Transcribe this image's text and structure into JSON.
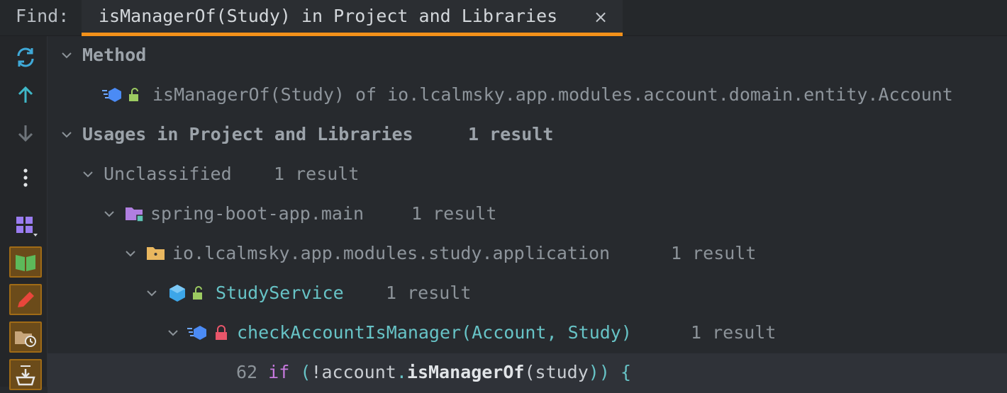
{
  "find": {
    "label": "Find:",
    "tab_title": "isManagerOf(Study) in Project and Libraries",
    "close_glyph": "×"
  },
  "sidebar": {
    "icons": [
      "refresh-icon",
      "arrow-up-icon",
      "arrow-down-icon",
      "more-vertical-icon",
      "layout-grid-icon",
      "book-icon",
      "pencil-icon",
      "folder-history-icon",
      "import-icon"
    ]
  },
  "tree": {
    "method_header": "Method",
    "method_item": "isManagerOf(Study) of io.lcalmsky.app.modules.account.domain.entity.Account",
    "usages_header": "Usages in Project and Libraries",
    "usages_count": "1 result",
    "unclassified": "Unclassified",
    "unclassified_count": "1 result",
    "module": "spring-boot-app.main",
    "module_count": "1 result",
    "package": "io.lcalmsky.app.modules.study.application",
    "package_count": "1 result",
    "class": "StudyService",
    "class_count": "1 result",
    "method": "checkAccountIsManager(Account, Study)",
    "method_count": "1 result",
    "code_line": {
      "line_number": "62",
      "keyword": "if",
      "open": "(",
      "bang_account": "!account",
      "dot": ".",
      "method": "isManagerOf",
      "args_open": "(",
      "arg": "study",
      "close": "))",
      "brace": "{"
    }
  },
  "colors": {
    "accent": "#F3911A",
    "teal": "#67C3C6",
    "keyword": "#C679DD",
    "background": "#272A2E"
  }
}
